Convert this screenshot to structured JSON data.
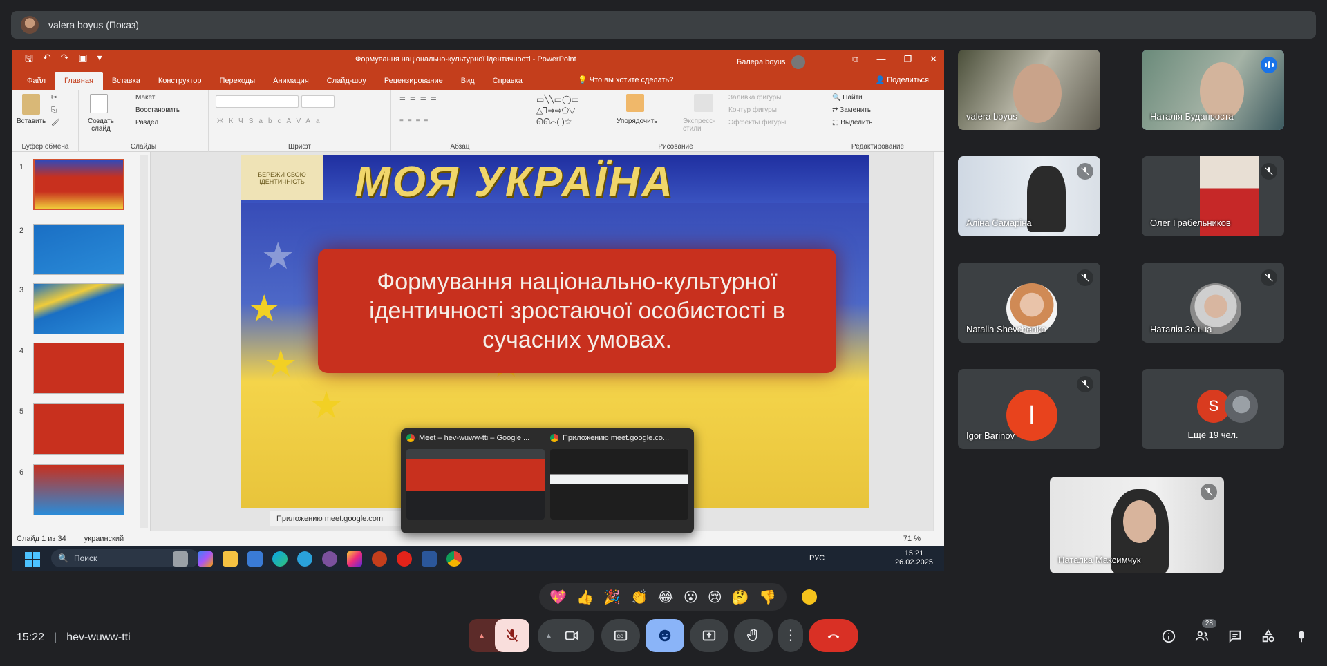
{
  "presenter_bar": {
    "title": "valera boyus (Показ)"
  },
  "powerpoint": {
    "doc_title": "Формування національно-культурної ідентичності  -  PowerPoint",
    "user": "Балера boyus",
    "tabs": [
      "Файл",
      "Главная",
      "Вставка",
      "Конструктор",
      "Переходы",
      "Анимация",
      "Слайд-шоу",
      "Рецензирование",
      "Вид",
      "Справка"
    ],
    "tell_me": "Что вы хотите сделать?",
    "share": "Поделиться",
    "ribbon": {
      "paste": "Вставить",
      "clipboard": "Буфер обмена",
      "new_slide": "Создать слайд",
      "layout": "Макет",
      "reset": "Восстановить",
      "section": "Раздел",
      "slides": "Слайды",
      "font": "Шрифт",
      "paragraph": "Абзац",
      "arrange": "Упорядочить",
      "styles": "Экспресс-стили",
      "fill": "Заливка фигуры",
      "outline": "Контур фигуры",
      "effects": "Эффекты фигуры",
      "drawing": "Рисование",
      "find": "Найти",
      "replace": "Заменить",
      "select": "Выделить",
      "editing": "Редактирование"
    },
    "slide_numbers": [
      "1",
      "2",
      "3",
      "4",
      "5",
      "6"
    ],
    "slide": {
      "banner": "МОЯ УКРАЇНА",
      "emblem": "БЕРЕЖИ СВОЮ ІДЕНТИЧНІСТЬ",
      "body": "Формування національно-культурної ідентичності зростаючої особистості в сучасних умовах."
    },
    "status_slide": "Слайд 1 из 34",
    "status_lang": "украинский",
    "zoom": "71 %"
  },
  "taskbar": {
    "search": "Поиск",
    "lang": "РУС",
    "time": "15:21",
    "date": "26.02.2025"
  },
  "preview": {
    "items": [
      {
        "title": "Meet – hev-wuww-tti – Google ..."
      },
      {
        "title": "Приложению meet.google.co..."
      }
    ],
    "bar_text": "Приложению meet.google.com"
  },
  "participants": [
    {
      "name": "valera boyus"
    },
    {
      "name": "Наталія Будапроста"
    },
    {
      "name": "Аліна Самаріна"
    },
    {
      "name": "Олег Грабельников"
    },
    {
      "name": "Natalia Shevchenko"
    },
    {
      "name": "Наталія Зєніна"
    },
    {
      "name": "Igor Barinov",
      "initial": "I"
    },
    {
      "name": "Ещё 19 чел.",
      "initial": "S"
    },
    {
      "name": "Наталка Максимчук"
    }
  ],
  "reactions": [
    "💖",
    "👍",
    "🎉",
    "👏",
    "😂",
    "😮",
    "😢",
    "🤔",
    "👎"
  ],
  "bottom": {
    "time": "15:22",
    "meeting_code": "hev-wuww-tti",
    "participant_count": "28"
  },
  "colors": {
    "ppt_accent": "#c43e1c",
    "meet_bg": "#202124",
    "end_call": "#d93025",
    "active_btn": "#8ab4f8"
  }
}
